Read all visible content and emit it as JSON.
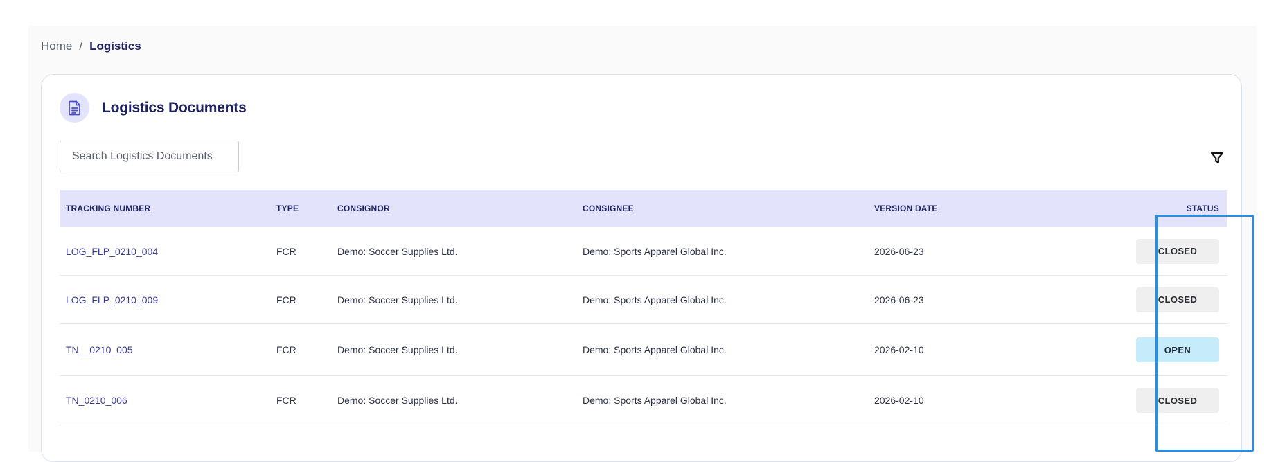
{
  "breadcrumb": {
    "home": "Home",
    "separator": "/",
    "current": "Logistics"
  },
  "card": {
    "title": "Logistics Documents",
    "icon": "document-icon"
  },
  "search": {
    "placeholder": "Search Logistics Documents"
  },
  "filter": {
    "icon": "filter-icon"
  },
  "table": {
    "headers": {
      "tracking_number": "TRACKING NUMBER",
      "type": "TYPE",
      "consignor": "CONSIGNOR",
      "consignee": "CONSIGNEE",
      "version_date": "VERSION DATE",
      "status": "STATUS"
    },
    "rows": [
      {
        "tracking_number": "LOG_FLP_0210_004",
        "type": "FCR",
        "consignor": "Demo: Soccer Supplies Ltd.",
        "consignee": "Demo: Sports Apparel Global Inc.",
        "version_date": "2026-06-23",
        "status": "CLOSED"
      },
      {
        "tracking_number": "LOG_FLP_0210_009",
        "type": "FCR",
        "consignor": "Demo: Soccer Supplies Ltd.",
        "consignee": "Demo: Sports Apparel Global Inc.",
        "version_date": "2026-06-23",
        "status": "CLOSED"
      },
      {
        "tracking_number": "TN__0210_005",
        "type": "FCR",
        "consignor": "Demo: Soccer Supplies Ltd.",
        "consignee": "Demo: Sports Apparel Global Inc.",
        "version_date": "2026-02-10",
        "status": "OPEN"
      },
      {
        "tracking_number": "TN_0210_006",
        "type": "FCR",
        "consignor": "Demo: Soccer Supplies Ltd.",
        "consignee": "Demo: Sports Apparel Global Inc.",
        "version_date": "2026-02-10",
        "status": "CLOSED"
      }
    ]
  },
  "colors": {
    "accent": "#1f2260",
    "header_bg": "#e3e3fb",
    "open_badge": "#c6ecfb",
    "closed_badge": "#efefef",
    "highlight": "#2b8de0"
  }
}
